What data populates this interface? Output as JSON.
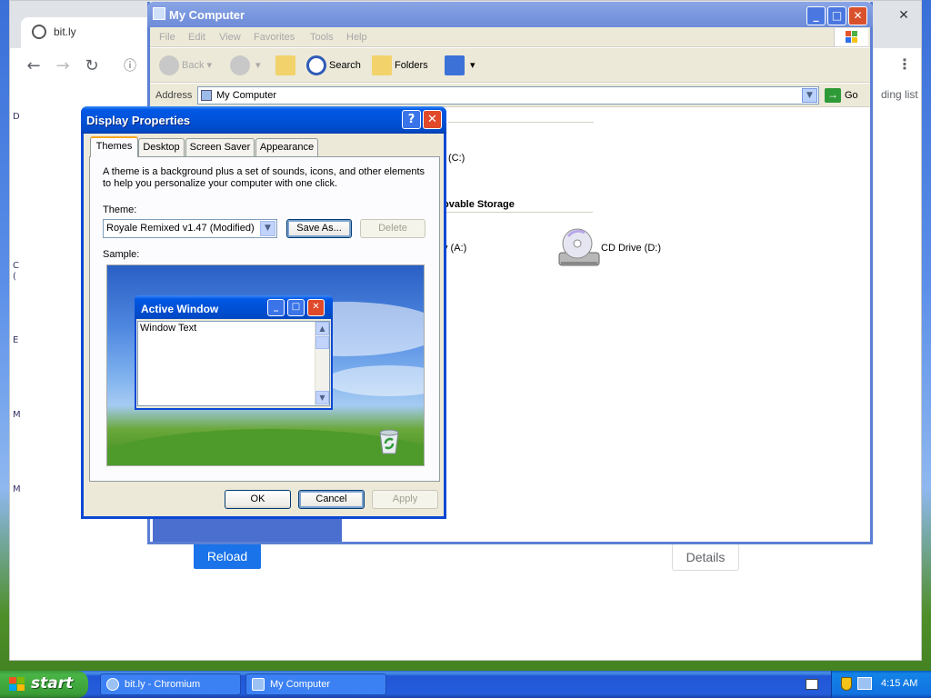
{
  "chromium": {
    "tab_title": "bit.ly",
    "tab_close": "✕",
    "window_close": "✕",
    "menu_dots": "⋮",
    "reading_list": "ding list",
    "reload_label": "Reload",
    "details_label": "Details",
    "edge_letters": [
      "D",
      "C",
      "(",
      "E",
      "M",
      "M"
    ]
  },
  "my_computer": {
    "title": "My Computer",
    "menu": [
      "File",
      "Edit",
      "View",
      "Favorites",
      "Tools",
      "Help"
    ],
    "toolbar": {
      "back": "Back",
      "search": "Search",
      "folders": "Folders"
    },
    "address_label": "Address",
    "address_value": "My Computer",
    "go_label": "Go",
    "drive_c_fragment": "(C:)",
    "section_removable": "ovable Storage",
    "drive_a_fragment": "y (A:)",
    "cd_drive": "CD Drive (D:)"
  },
  "display_properties": {
    "title": "Display Properties",
    "help": "?",
    "close": "✕",
    "tabs": [
      "Themes",
      "Desktop",
      "Screen Saver",
      "Appearance"
    ],
    "description": "A theme is a background plus a set of sounds, icons, and other elements to help you personalize your computer with one click.",
    "theme_label": "Theme:",
    "theme_value": "Royale Remixed v1.47 (Modified)",
    "save_as": "Save As...",
    "delete": "Delete",
    "sample_label": "Sample:",
    "active_window_title": "Active Window",
    "window_text": "Window Text",
    "ok": "OK",
    "cancel": "Cancel",
    "apply": "Apply"
  },
  "taskbar": {
    "start_label": "start",
    "tasks": [
      "bit.ly - Chromium",
      "My Computer"
    ],
    "clock": "4:15 AM"
  }
}
